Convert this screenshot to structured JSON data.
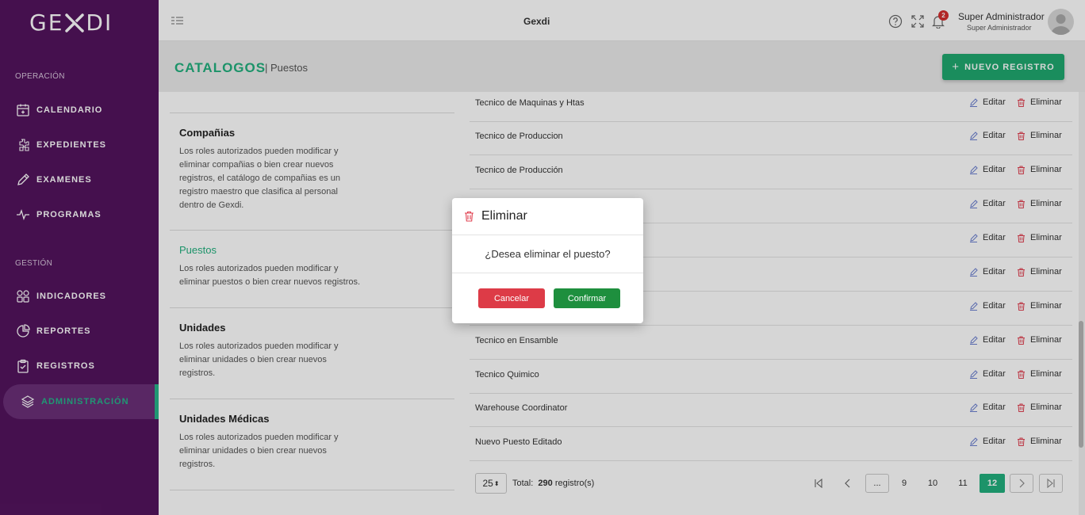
{
  "app": {
    "logo_text_left": "GE",
    "logo_text_right": "DI",
    "title": "Gexdi",
    "notification_count": "2",
    "user_name": "Super Administrador",
    "user_role": "Super Administrador"
  },
  "sidebar": {
    "section_operacion": "OPERACIÓN",
    "section_gestion": "GESTIÓN",
    "items": [
      {
        "label": "CALENDARIO",
        "icon": "calendar-icon"
      },
      {
        "label": "EXPEDIENTES",
        "icon": "puzzle-icon"
      },
      {
        "label": "EXAMENES",
        "icon": "pencil-icon"
      },
      {
        "label": "PROGRAMAS",
        "icon": "activity-icon"
      },
      {
        "label": "INDICADORES",
        "icon": "grid-icon"
      },
      {
        "label": "REPORTES",
        "icon": "pie-chart-icon"
      },
      {
        "label": "REGISTROS",
        "icon": "clipboard-icon"
      },
      {
        "label": "ADMINISTRACIÓN",
        "icon": "layers-icon",
        "active": true
      }
    ]
  },
  "header": {
    "title": "CATALOGOS",
    "subtitle": "| Puestos",
    "new_button": "NUEVO REGISTRO"
  },
  "catalogs": [
    {
      "title": "Compañias",
      "description": "Los roles autorizados pueden modificar y eliminar compañias o bien crear nuevos registros, el catálogo de compañias es un registro maestro que clasifica al personal dentro de Gexdi."
    },
    {
      "title": "Puestos",
      "description": "Los roles autorizados pueden modificar y eliminar puestos o bien crear nuevos registros.",
      "active": true
    },
    {
      "title": "Unidades",
      "description": "Los roles autorizados pueden modificar y eliminar unidades o bien crear nuevos registros."
    },
    {
      "title": "Unidades Médicas",
      "description": "Los roles autorizados pueden modificar y eliminar unidades o bien crear nuevos registros."
    }
  ],
  "table": {
    "edit_label": "Editar",
    "delete_label": "Eliminar",
    "rows": [
      "Tecnico de Maquinas y Htas",
      "Tecnico de Produccion",
      "Tecnico de Producción",
      "",
      "",
      "",
      "",
      "Tecnico en Ensamble",
      "Tecnico Quimico",
      "Warehouse Coordinator",
      "Nuevo Puesto Editado"
    ]
  },
  "pagination": {
    "page_size": "25",
    "total_label": "Total:",
    "total_count": "290",
    "total_suffix": "registro(s)",
    "ellipsis": "...",
    "pages": [
      "9",
      "10",
      "11",
      "12"
    ],
    "current_page": "12"
  },
  "modal": {
    "title": "Eliminar",
    "message": "¿Desea eliminar el puesto?",
    "cancel": "Cancelar",
    "confirm": "Confirmar"
  },
  "colors": {
    "sidebar": "#53145e",
    "accent": "#22b07e",
    "danger": "#dd3b47",
    "confirm": "#1e8f3e"
  }
}
